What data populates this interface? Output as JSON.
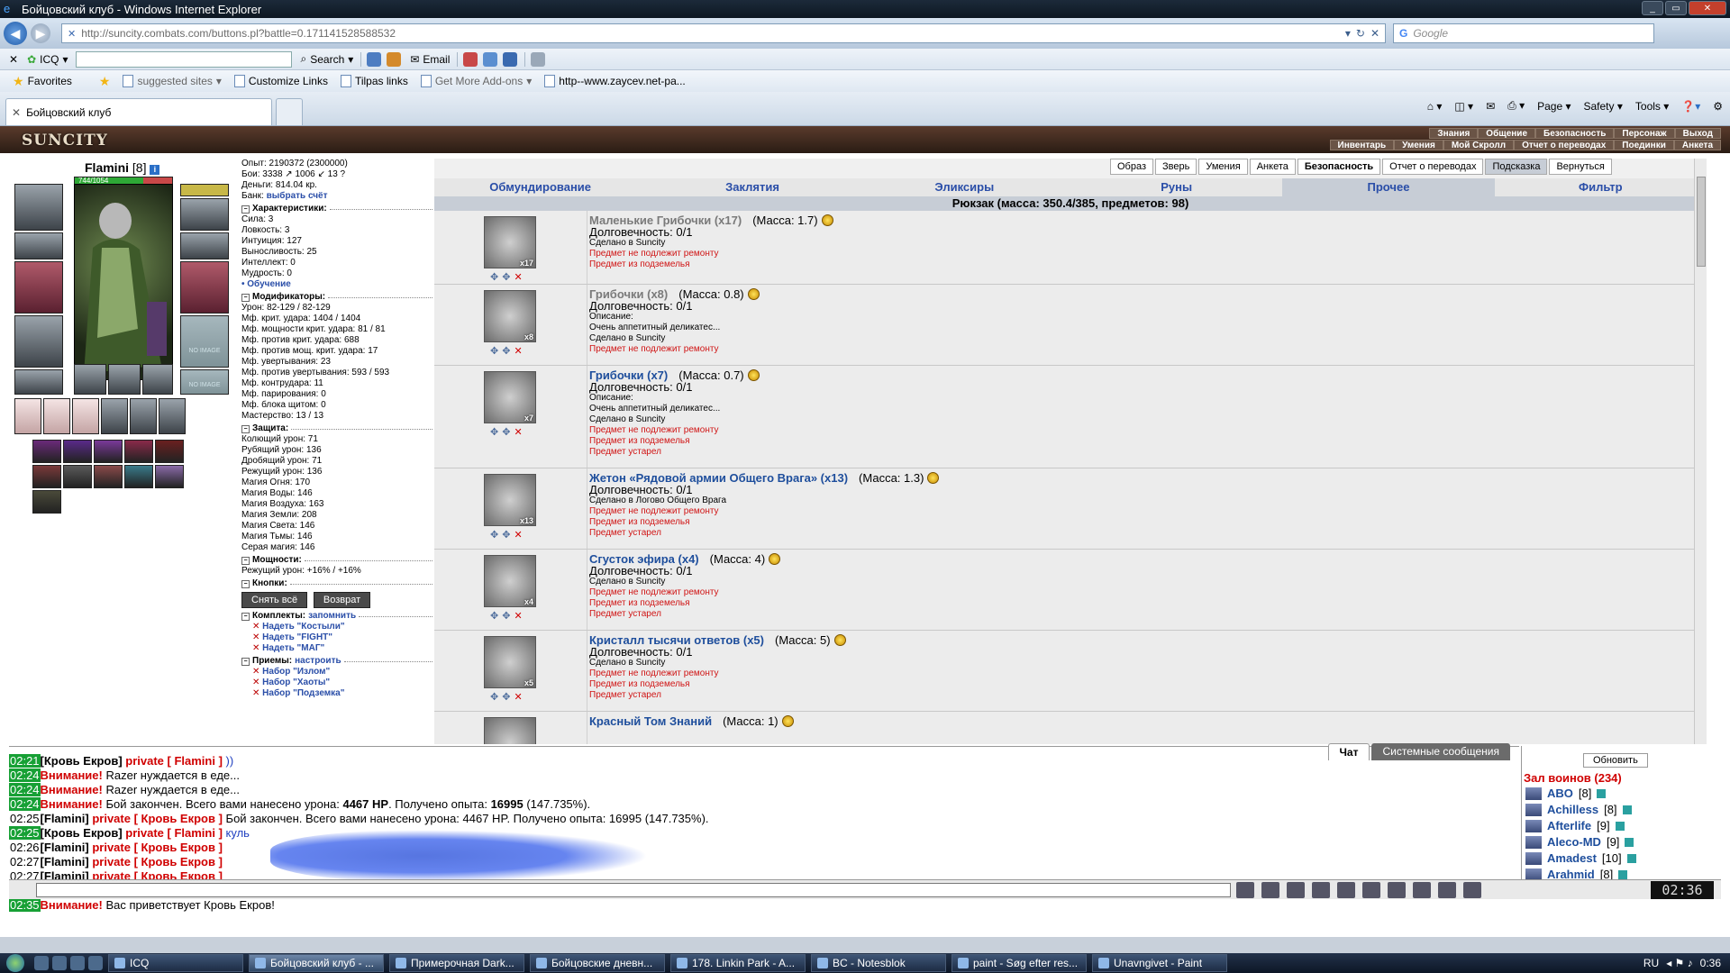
{
  "window": {
    "title": "Бойцовский клуб - Windows Internet Explorer"
  },
  "address": {
    "url": "http://suncity.combats.com/buttons.pl?battle=0.171141528588532",
    "search_placeholder": "Google"
  },
  "toolbar": {
    "icq": "ICQ",
    "search": "Search",
    "email": "Email"
  },
  "favorites": {
    "favorites_label": "Favorites",
    "items": [
      "suggested sites",
      "Customize Links",
      "Tilpas links",
      "Get More Add-ons",
      "http--www.zaycev.net-pa..."
    ]
  },
  "tab": {
    "title": "Бойцовский клуб"
  },
  "commandbar": {
    "page": "Page",
    "safety": "Safety",
    "tools": "Tools"
  },
  "game": {
    "logo": "SUNCITY",
    "menu_top": [
      "Знания",
      "Общение",
      "Безопасность",
      "Персонаж",
      "Выход"
    ],
    "menu_bottom": [
      "Инвентарь",
      "Умения",
      "Мой Скролл",
      "Отчет о переводах",
      "Поединки",
      "Анкета"
    ],
    "character": {
      "name": "Flamini",
      "level": "[8]",
      "hp": "744/1054",
      "hp_fraction": 0.706
    },
    "stats": {
      "exp": "Опыт: 2190372 (2300000)",
      "battles": "Бои: 3338 ↗ 1006 ↙ 13 ?",
      "money": "Деньги: 814.04 кр.",
      "bank_label": "Банк:",
      "bank_link": "выбрать счёт",
      "char_header": "Характеристики:",
      "attrs": [
        "Сила: 3",
        "Ловкость: 3",
        "Интуиция: 127",
        "Выносливость: 25",
        "Интеллект: 0",
        "Мудрость: 0"
      ],
      "training": "• Обучение",
      "mods_header": "Модификаторы:",
      "mods": [
        "Урон: 82-129 / 82-129",
        "Мф. крит. удара: 1404 / 1404",
        "Мф. мощности крит. удара: 81 / 81",
        "Мф. против крит. удара: 688",
        "Мф. против мощ. крит. удара: 17",
        "Мф. увертывания: 23",
        "Мф. против увертывания: 593 / 593",
        "Мф. контрудара: 11",
        "Мф. парирования: 0",
        "Мф. блока щитом: 0",
        "Мастерство: 13 / 13"
      ],
      "def_header": "Защита:",
      "defs": [
        "Колющий урон: 71",
        "Рубящий урон: 136",
        "Дробящий урон: 71",
        "Режущий урон: 136",
        "Магия Огня: 170",
        "Магия Воды: 146",
        "Магия Воздуха: 163",
        "Магия Земли: 208",
        "Магия Света: 146",
        "Магия Тьмы: 146",
        "Серая магия: 146"
      ],
      "power_header": "Мощности:",
      "power": "Режущий урон: +16% / +16%",
      "buttons_header": "Кнопки:",
      "btn_remove_all": "Снять всё",
      "btn_return": "Возврат",
      "sets_header": "Комплекты:",
      "sets_remember": "запомнить",
      "sets": [
        "Надеть \"Костыли\"",
        "Надеть \"FIGHT\"",
        "Надеть \"МАГ\""
      ],
      "tricks_header": "Приемы:",
      "tricks_setup": "настроить",
      "tricks": [
        "Набор \"Излом\"",
        "Набор \"Хаоты\"",
        "Набор \"Подземка\""
      ]
    },
    "inventory": {
      "top_buttons": [
        "Образ",
        "Зверь",
        "Умения",
        "Анкета",
        "Безопасность",
        "Отчет о переводах",
        "Подсказка",
        "Вернуться"
      ],
      "tabs": [
        "Обмундирование",
        "Заклятия",
        "Эликсиры",
        "Руны",
        "Прочее",
        "Фильтр"
      ],
      "active_tab": "Прочее",
      "bag": "Рюкзак (масса: 350.4/385, предметов: 98)",
      "items": [
        {
          "name": "Маленькие Грибочки (x17)",
          "mass": "(Масса: 1.7)",
          "count": "x17",
          "lines": [
            "Долговечность: 0/1",
            "Сделано в Suncity"
          ],
          "red": [
            "Предмет не подлежит ремонту",
            "Предмет из подземелья"
          ],
          "grey": true
        },
        {
          "name": "Грибочки (x8)",
          "mass": "(Масса: 0.8)",
          "count": "x8",
          "lines": [
            "Долговечность: 0/1",
            "Описание:",
            "Очень аппетитный деликатес...",
            "Сделано в Suncity"
          ],
          "red": [
            "Предмет не подлежит ремонту"
          ],
          "grey": true
        },
        {
          "name": "Грибочки (x7)",
          "mass": "(Масса: 0.7)",
          "count": "x7",
          "lines": [
            "Долговечность: 0/1",
            "Описание:",
            "Очень аппетитный деликатес...",
            "Сделано в Suncity"
          ],
          "red": [
            "Предмет не подлежит ремонту",
            "Предмет из подземелья",
            "Предмет устарел"
          ],
          "grey": false
        },
        {
          "name": "Жетон «Рядовой армии Общего Врага» (x13)",
          "mass": "(Масса: 1.3)",
          "count": "x13",
          "lines": [
            "Долговечность: 0/1",
            "Сделано в Логово Общего Врага"
          ],
          "red": [
            "Предмет не подлежит ремонту",
            "Предмет из подземелья",
            "Предмет устарел"
          ],
          "grey": false
        },
        {
          "name": "Сгусток эфира (x4)",
          "mass": "(Масса: 4)",
          "count": "x4",
          "lines": [
            "Долговечность: 0/1",
            "Сделано в Suncity"
          ],
          "red": [
            "Предмет не подлежит ремонту",
            "Предмет из подземелья",
            "Предмет устарел"
          ],
          "grey": false
        },
        {
          "name": "Кристалл тысячи ответов (x5)",
          "mass": "(Масса: 5)",
          "count": "x5",
          "lines": [
            "Долговечность: 0/1",
            "Сделано в Suncity"
          ],
          "red": [
            "Предмет не подлежит ремонту",
            "Предмет из подземелья",
            "Предмет устарел"
          ],
          "grey": false
        },
        {
          "name": "Красный Том Знаний",
          "mass": "(Масса: 1)",
          "count": "",
          "lines": [],
          "red": [],
          "grey": false
        }
      ]
    },
    "chat": {
      "tabs": [
        "Чат",
        "Системные сообщения"
      ],
      "lines": [
        {
          "time": "02:21",
          "parts": [
            [
              "nick",
              "[Кровь Екров]"
            ],
            [
              "red",
              " private [ Flamini ]"
            ],
            [
              "ex",
              " ))"
            ]
          ],
          "green": true
        },
        {
          "time": "02:24",
          "parts": [
            [
              "red",
              "Внимание!"
            ],
            [
              "plain",
              " Razer нуждается в еде..."
            ]
          ],
          "green": true
        },
        {
          "time": "02:24",
          "parts": [
            [
              "red",
              "Внимание!"
            ],
            [
              "plain",
              " Razer нуждается в еде..."
            ]
          ],
          "green": true
        },
        {
          "time": "02:24",
          "parts": [
            [
              "red",
              "Внимание!"
            ],
            [
              "plain",
              " Бой закончен. Всего вами нанесено урона: "
            ],
            [
              "nick",
              "4467 HP"
            ],
            [
              "plain",
              ". Получено опыта: "
            ],
            [
              "nick",
              "16995"
            ],
            [
              "plain",
              " (147.735%)."
            ]
          ],
          "green": true
        },
        {
          "time": "02:25",
          "parts": [
            [
              "nick",
              "[Flamini]"
            ],
            [
              "red",
              " private [ Кровь Екров ]"
            ],
            [
              "plain",
              " Бой закончен. Всего вами нанесено урона: 4467 HP. Получено опыта: 16995 (147.735%)."
            ]
          ],
          "green": false
        },
        {
          "time": "02:25",
          "parts": [
            [
              "nick",
              "[Кровь Екров]"
            ],
            [
              "red",
              " private [ Flamini ]"
            ],
            [
              "ex",
              " куль"
            ]
          ],
          "green": true
        },
        {
          "time": "02:26",
          "parts": [
            [
              "nick",
              "[Flamini]"
            ],
            [
              "red",
              " private [ Кровь Екров ]"
            ]
          ],
          "green": false
        },
        {
          "time": "02:27",
          "parts": [
            [
              "nick",
              "[Flamini]"
            ],
            [
              "red",
              " private [ Кровь Екров ]"
            ]
          ],
          "green": false
        },
        {
          "time": "02:27",
          "parts": [
            [
              "nick",
              "[Flamini]"
            ],
            [
              "red",
              " private [ Кровь Екров ]"
            ]
          ],
          "green": false
        },
        {
          "time": "02:31",
          "parts": [
            [
              "nick",
              "[Кровь Екров]"
            ],
            [
              "red",
              " private [ Flamini ]"
            ]
          ],
          "green": true
        },
        {
          "time": "02:35",
          "parts": [
            [
              "red",
              "Внимание!"
            ],
            [
              "plain",
              " Вас приветствует Кровь Екров!"
            ]
          ],
          "green": true
        }
      ]
    },
    "players": {
      "refresh": "Обновить",
      "hall": "Зал воинов (234)",
      "list": [
        {
          "name": "ABO",
          "level": "[8]"
        },
        {
          "name": "Achilless",
          "level": "[8]"
        },
        {
          "name": "Afterlife",
          "level": "[9]"
        },
        {
          "name": "Aleco-MD",
          "level": "[9]"
        },
        {
          "name": "Amadest",
          "level": "[10]"
        },
        {
          "name": "Arahmid",
          "level": "[8]"
        }
      ]
    },
    "clock": "02:36"
  },
  "taskbar": {
    "tasks": [
      "ICQ",
      "Бойцовский клуб - ...",
      "Примерочная Dark...",
      "Бойцовские дневн...",
      "178. Linkin Park - A...",
      "BC - Notesblok",
      "paint - Søg efter res...",
      "Unavngivet - Paint"
    ],
    "lang": "RU",
    "time": "0:36"
  }
}
